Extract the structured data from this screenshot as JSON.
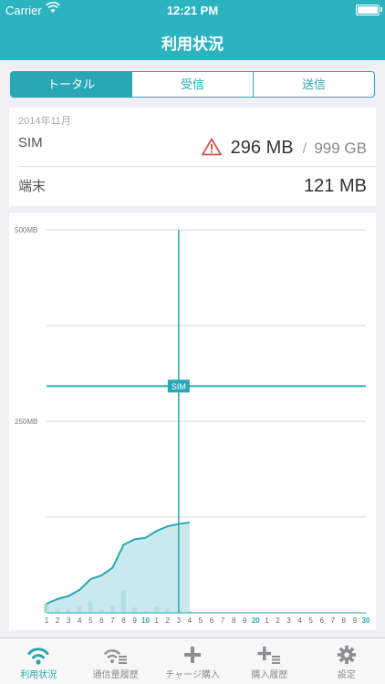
{
  "status_bar": {
    "carrier": "Carrier",
    "time": "12:21 PM"
  },
  "nav": {
    "title": "利用状況"
  },
  "segments": [
    {
      "label": "トータル",
      "active": true
    },
    {
      "label": "受信",
      "active": false
    },
    {
      "label": "送信",
      "active": false
    }
  ],
  "summary": {
    "month": "2014年11月",
    "sim_label": "SIM",
    "sim_usage": "296 MB",
    "sim_separator": "/",
    "sim_capacity": "999 GB",
    "device_label": "端末",
    "device_usage": "121 MB"
  },
  "chart_data": {
    "type": "area",
    "accent_color": "#2aa7b4",
    "fill_color": "#b5e3e8",
    "y_labels": [
      "500MB",
      "250MB"
    ],
    "ylim": [
      0,
      500
    ],
    "y_unit": "MB",
    "x_ticks": [
      "1",
      "2",
      "3",
      "4",
      "5",
      "6",
      "7",
      "8",
      "9",
      "10",
      "1",
      "2",
      "3",
      "4",
      "5",
      "6",
      "7",
      "8",
      "9",
      "20",
      "1",
      "2",
      "3",
      "4",
      "5",
      "6",
      "7",
      "8",
      "9",
      "30"
    ],
    "x_highlight": [
      "10",
      "20",
      "30"
    ],
    "cumulative_series": {
      "name": "",
      "x": [
        1,
        2,
        3,
        4,
        5,
        6,
        7,
        8,
        9,
        10,
        11,
        12,
        13,
        14
      ],
      "values": [
        12,
        18,
        22,
        30,
        44,
        49,
        59,
        89,
        96,
        98,
        107,
        113,
        116,
        118
      ]
    },
    "daily_series": {
      "x": [
        1,
        2,
        3,
        4,
        5,
        6,
        7,
        8,
        9,
        10,
        11,
        12,
        13,
        14
      ],
      "values": [
        12,
        6,
        4,
        8,
        14,
        5,
        10,
        30,
        7,
        2,
        9,
        6,
        3,
        2
      ]
    },
    "marker": {
      "label": "SIM",
      "x": 13.0,
      "y_value": 296
    }
  },
  "tab_bar": {
    "items": [
      {
        "label": "利用状況",
        "icon": "wifi-icon",
        "active": true
      },
      {
        "label": "通信量履歴",
        "icon": "wifi-list-icon",
        "active": false
      },
      {
        "label": "チャージ購入",
        "icon": "plus-icon",
        "active": false
      },
      {
        "label": "購入履歴",
        "icon": "plus-list-icon",
        "active": false
      },
      {
        "label": "設定",
        "icon": "gear-icon",
        "active": false
      }
    ]
  }
}
